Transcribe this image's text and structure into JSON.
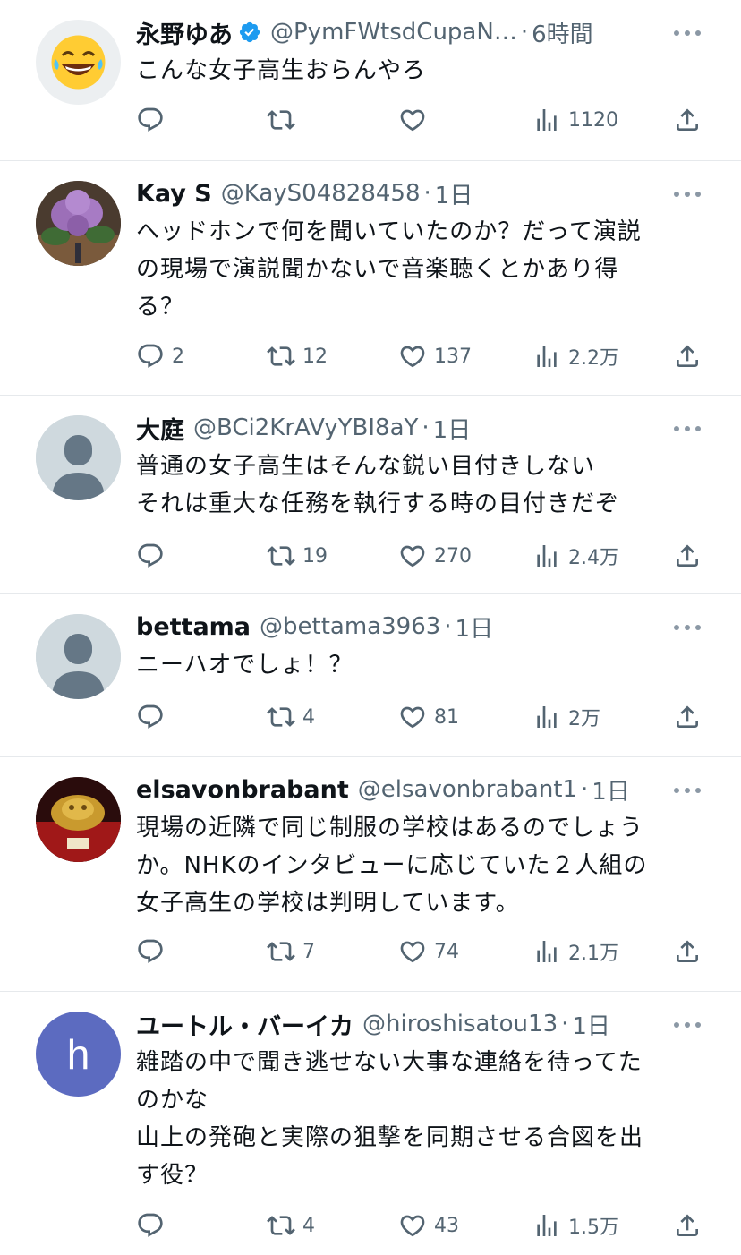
{
  "colors": {
    "text": "#0f1419",
    "secondary": "#536471",
    "verified": "#1d9bf0",
    "divider": "#e6e9ec"
  },
  "replies": [
    {
      "name": "永野ゆあ",
      "verified": true,
      "handle": "@PymFWtsdCupaN…",
      "time": "6時間",
      "avatar": "laughing-emoji-avatar",
      "lines": [
        "こんな女子高生おらんやろ"
      ],
      "reply_count": "",
      "retweet_count": "",
      "like_count": "",
      "view_count": "1120"
    },
    {
      "name": "Kay S",
      "verified": false,
      "handle": "@KayS04828458",
      "time": "1日",
      "avatar": "hydrangea-photo-avatar",
      "lines": [
        "ヘッドホンで何を聞いていたのか？だって演説",
        "の現場で演説聞かないで音楽聴くとかあり得",
        "る？"
      ],
      "reply_count": "2",
      "retweet_count": "12",
      "like_count": "137",
      "view_count": "2.2万"
    },
    {
      "name": "大庭",
      "verified": false,
      "handle": "@BCi2KrAVyYBI8aY",
      "time": "1日",
      "avatar": "default-avatar",
      "lines": [
        "普通の女子高生はそんな鋭い目付きしない",
        "それは重大な任務を執行する時の目付きだぞ"
      ],
      "reply_count": "",
      "retweet_count": "19",
      "like_count": "270",
      "view_count": "2.4万"
    },
    {
      "name": "bettama",
      "verified": false,
      "handle": "@bettama3963",
      "time": "1日",
      "avatar": "default-avatar",
      "lines": [
        "ニーハオでしょ！？"
      ],
      "reply_count": "",
      "retweet_count": "4",
      "like_count": "81",
      "view_count": "2万"
    },
    {
      "name": "elsavonbrabant",
      "verified": false,
      "handle": "@elsavonbrabant1",
      "time": "1日",
      "avatar": "golden-statue-photo-avatar",
      "lines": [
        "現場の近隣で同じ制服の学校はあるのでしょう",
        "か。NHKのインタビューに応じていた２人組の",
        "女子高生の学校は判明しています。"
      ],
      "reply_count": "",
      "retweet_count": "7",
      "like_count": "74",
      "view_count": "2.1万"
    },
    {
      "name": "ユートル・バーイカ",
      "verified": false,
      "handle": "@hiroshisatou13",
      "time": "1日",
      "avatar": "letter-avatar",
      "avatar_letter": "h",
      "avatar_color": "#5c6bc0",
      "lines": [
        "雑踏の中で聞き逃せない大事な連絡を待ってた",
        "のかな",
        "山上の発砲と実際の狙撃を同期させる合図を出",
        "す役？"
      ],
      "reply_count": "",
      "retweet_count": "4",
      "like_count": "43",
      "view_count": "1.5万"
    }
  ]
}
